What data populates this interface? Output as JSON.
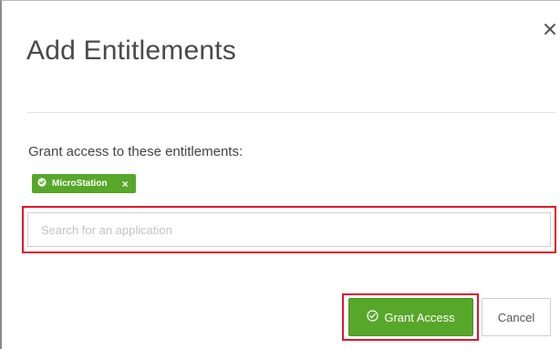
{
  "modal": {
    "title": "Add Entitlements",
    "close_icon": "close-icon"
  },
  "form": {
    "instruction": "Grant access to these entitlements:",
    "selected_entitlements": [
      {
        "label": "MicroStation",
        "icon": "check-circle-icon",
        "remove_icon": "close-icon"
      }
    ],
    "search": {
      "placeholder": "Search for an application",
      "value": ""
    }
  },
  "actions": {
    "grant_label": "Grant Access",
    "grant_icon": "shield-check-icon",
    "cancel_label": "Cancel"
  },
  "colors": {
    "accent_green": "#57a72a",
    "highlight_red": "#e0162b",
    "title_gray": "#4a4a4a"
  }
}
